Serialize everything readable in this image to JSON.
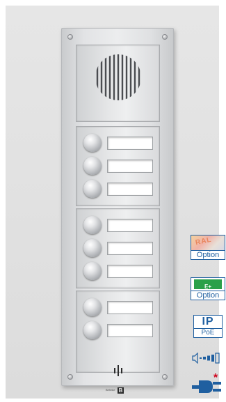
{
  "product": {
    "name": "door intercom panel",
    "module_counts": {
      "button_module_1": 3,
      "button_module_2": 3,
      "button_module_3": 2
    }
  },
  "logo": {
    "text": "Behnke",
    "mark": "B"
  },
  "badges": {
    "ral": {
      "swatch_text": "RAL",
      "label": "Option"
    },
    "eplus": {
      "swatch_text": "E+",
      "label": "Option"
    },
    "ip": {
      "big_text": "IP",
      "label": "PoE"
    }
  },
  "icons": {
    "volume": "volume-level-icon",
    "plug": "power-plug-icon",
    "plug_marker": "*"
  },
  "colors": {
    "badge_blue": "#1f5fa0",
    "eplus_green": "#2aa04a",
    "star_red": "#d0021b",
    "plug_blue": "#1f5fa0"
  }
}
